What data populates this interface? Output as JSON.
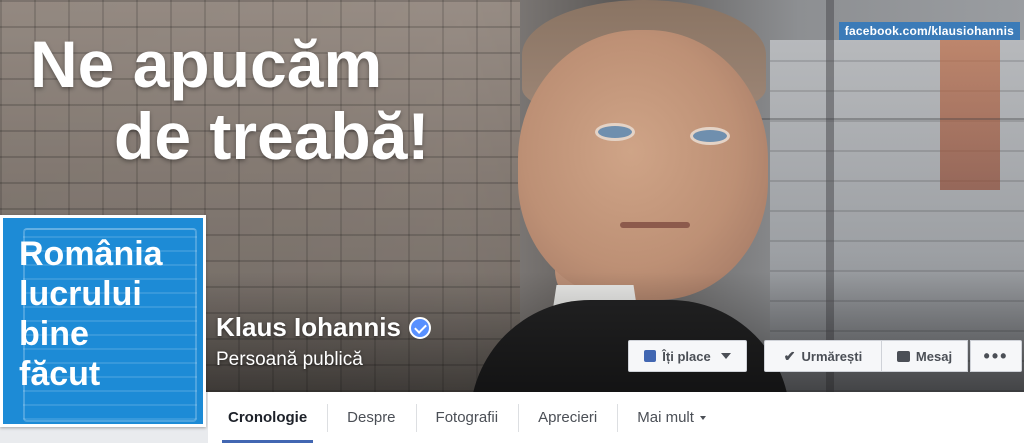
{
  "cover": {
    "headline_line1": "Ne apucăm",
    "headline_line2": "de treabă!",
    "watermark": "facebook.com/klausiohannis"
  },
  "profile": {
    "pic_lines": [
      "România",
      "lucrului",
      "bine",
      "făcut"
    ],
    "name": "Klaus Iohannis",
    "verified": true,
    "category": "Persoană publică"
  },
  "actions": {
    "like_label": "Îți place",
    "follow_label": "Urmărești",
    "message_label": "Mesaj",
    "more_label": "•••"
  },
  "tabs": [
    {
      "label": "Cronologie",
      "active": true
    },
    {
      "label": "Despre",
      "active": false
    },
    {
      "label": "Fotografii",
      "active": false
    },
    {
      "label": "Aprecieri",
      "active": false
    },
    {
      "label": "Mai mult",
      "active": false
    }
  ],
  "colors": {
    "accent": "#4267b2",
    "profile_bg": "#1d8bd6",
    "verified": "#5890ff",
    "watermark_bg": "#3b7bb8"
  }
}
